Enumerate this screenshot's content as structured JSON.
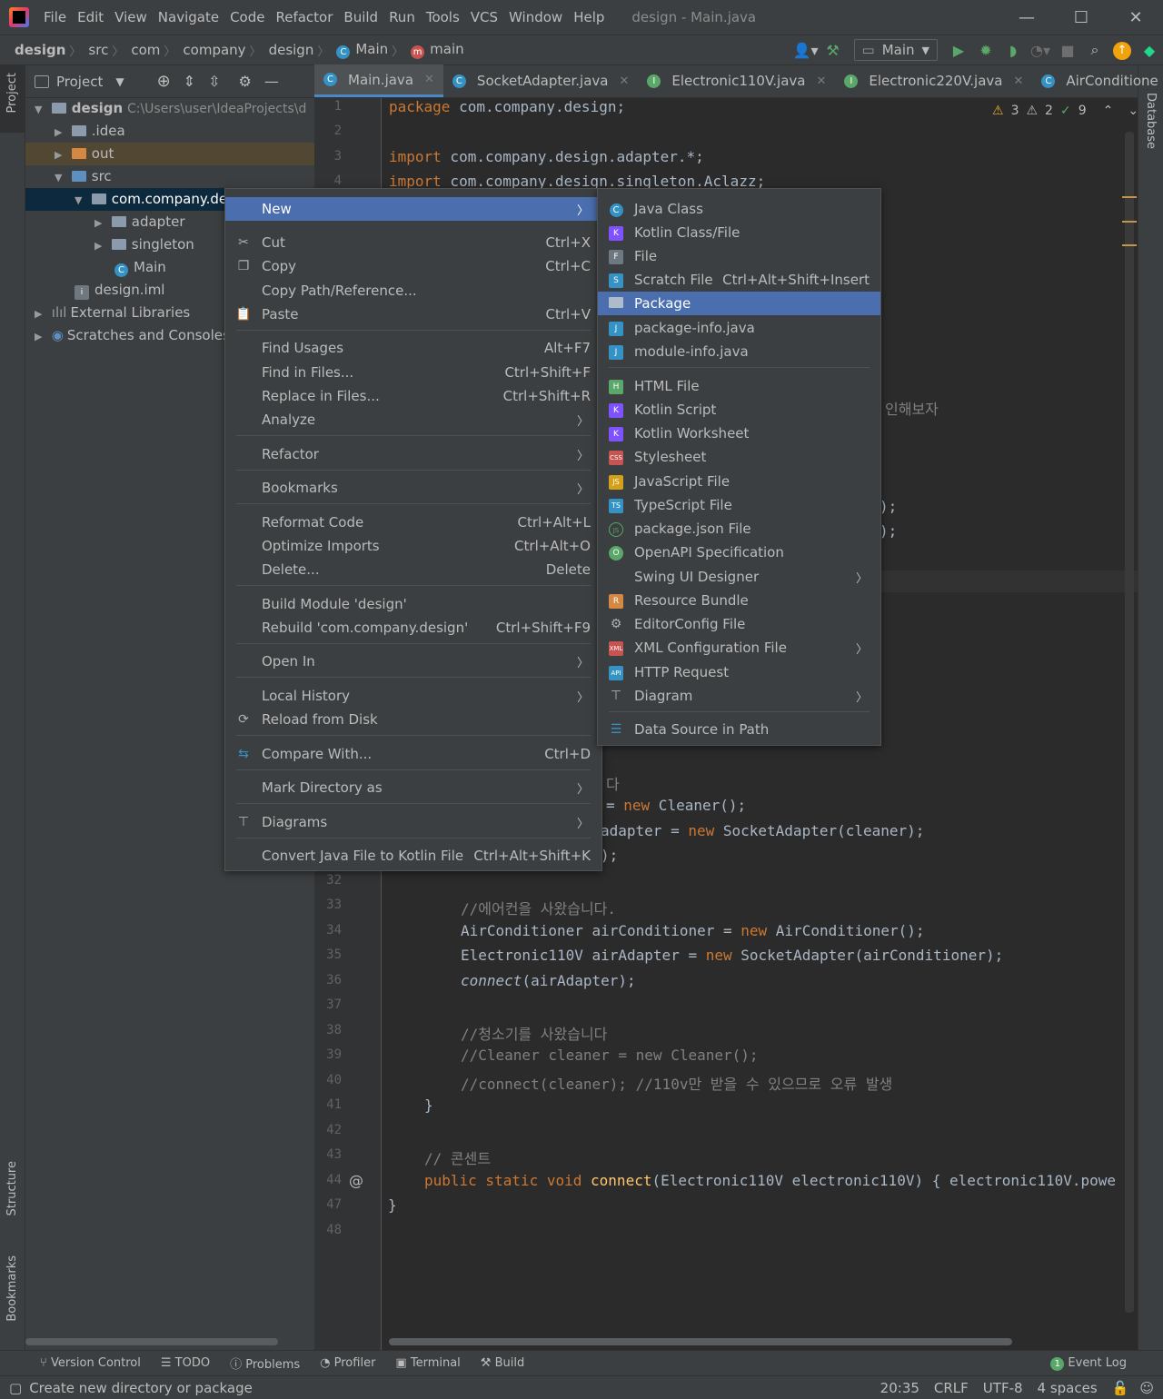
{
  "menubar": {
    "items": [
      "File",
      "Edit",
      "View",
      "Navigate",
      "Code",
      "Refactor",
      "Build",
      "Run",
      "Tools",
      "VCS",
      "Window",
      "Help"
    ],
    "title": "design - Main.java"
  },
  "navbar": {
    "crumbs": [
      "design",
      "src",
      "com",
      "company",
      "design",
      "Main",
      "main"
    ],
    "run_config": "Main"
  },
  "left_strip": {
    "project": "Project",
    "structure": "Structure",
    "bookmarks": "Bookmarks"
  },
  "right_strip": {
    "database": "Database"
  },
  "project_panel": {
    "title": "Project",
    "tree": [
      {
        "label": "design",
        "path": "C:\\Users\\user\\IdeaProjects\\d",
        "bold": true
      },
      {
        "label": ".idea"
      },
      {
        "label": "out"
      },
      {
        "label": "src"
      },
      {
        "label": "com.company.des"
      },
      {
        "label": "adapter"
      },
      {
        "label": "singleton"
      },
      {
        "label": "Main"
      },
      {
        "label": "design.iml"
      },
      {
        "label": "External Libraries"
      },
      {
        "label": "Scratches and Consoles"
      }
    ]
  },
  "tabs": [
    "Main.java",
    "SocketAdapter.java",
    "Electronic110V.java",
    "Electronic220V.java",
    "AirConditione"
  ],
  "inspections": {
    "warnings": "3",
    "weak_warnings": "2",
    "typos": "9"
  },
  "editor": {
    "line_numbers": [
      "1",
      "2",
      "3",
      "4",
      "32",
      "33",
      "34",
      "35",
      "36",
      "37",
      "38",
      "39",
      "40",
      "41",
      "42",
      "43",
      "44",
      "47",
      "48"
    ],
    "code": {
      "l1_kw": "package",
      "l1_rest": " com.company.design;",
      "l3_kw": "import",
      "l3_rest": " com.company.design.adapter.*;",
      "l4_kw": "import",
      "l4_rest": " com.company.design.singleton.Aclazz;",
      "frag_korean": "인해보자",
      "frag_a": ");",
      "frag_b": ");",
      "frag_da": "다",
      "frag_c1": "= ",
      "frag_c2": "new",
      " frag_c3": " Cleaner();",
      "frag_d1": "adapter = ",
      "frag_d2": "new",
      "frag_d3": " SocketAdapter(cleaner);",
      "frag_e": ");",
      "l33": "//에어컨을 사왔습니다.",
      "l34_a": "AirConditioner airConditioner = ",
      "l34_b": "new",
      "l34_c": " AirConditioner();",
      "l35_a": "Electronic110V airAdapter = ",
      "l35_b": "new",
      "l35_c": " SocketAdapter(airConditioner);",
      "l36_a": "connect",
      "l36_b": "(airAdapter);",
      "l38": "//청소기를 사왔습니다",
      "l39": "//Cleaner cleaner = new Cleaner();",
      "l40": "//connect(cleaner); //110v만 받을 수 있으므로 오류 발생",
      "l41": "}",
      "l43": "// 콘센트",
      "l44_a": "public static void ",
      "l44_b": "connect",
      "l44_c": "(Electronic110V electronic110V) { electronic110V.powe",
      "l47": "}"
    }
  },
  "context_menu": {
    "items": [
      {
        "label": "New",
        "shortcut": "",
        "submenu": true
      },
      {
        "label": "Cut",
        "shortcut": "Ctrl+X"
      },
      {
        "label": "Copy",
        "shortcut": "Ctrl+C"
      },
      {
        "label": "Copy Path/Reference...",
        "shortcut": ""
      },
      {
        "label": "Paste",
        "shortcut": "Ctrl+V"
      },
      {
        "label": "Find Usages",
        "shortcut": "Alt+F7"
      },
      {
        "label": "Find in Files...",
        "shortcut": "Ctrl+Shift+F"
      },
      {
        "label": "Replace in Files...",
        "shortcut": "Ctrl+Shift+R"
      },
      {
        "label": "Analyze",
        "shortcut": "",
        "submenu": true
      },
      {
        "label": "Refactor",
        "shortcut": "",
        "submenu": true
      },
      {
        "label": "Bookmarks",
        "shortcut": "",
        "submenu": true
      },
      {
        "label": "Reformat Code",
        "shortcut": "Ctrl+Alt+L"
      },
      {
        "label": "Optimize Imports",
        "shortcut": "Ctrl+Alt+O"
      },
      {
        "label": "Delete...",
        "shortcut": "Delete"
      },
      {
        "label": "Build Module 'design'",
        "shortcut": ""
      },
      {
        "label": "Rebuild 'com.company.design'",
        "shortcut": "Ctrl+Shift+F9"
      },
      {
        "label": "Open In",
        "shortcut": "",
        "submenu": true
      },
      {
        "label": "Local History",
        "shortcut": "",
        "submenu": true
      },
      {
        "label": "Reload from Disk",
        "shortcut": ""
      },
      {
        "label": "Compare With...",
        "shortcut": "Ctrl+D"
      },
      {
        "label": "Mark Directory as",
        "shortcut": "",
        "submenu": true
      },
      {
        "label": "Diagrams",
        "shortcut": "",
        "submenu": true
      },
      {
        "label": "Convert Java File to Kotlin File",
        "shortcut": "Ctrl+Alt+Shift+K"
      }
    ]
  },
  "new_submenu": {
    "items": [
      {
        "label": "Java Class",
        "shortcut": ""
      },
      {
        "label": "Kotlin Class/File",
        "shortcut": ""
      },
      {
        "label": "File",
        "shortcut": ""
      },
      {
        "label": "Scratch File",
        "shortcut": "Ctrl+Alt+Shift+Insert"
      },
      {
        "label": "Package",
        "shortcut": ""
      },
      {
        "label": "package-info.java",
        "shortcut": ""
      },
      {
        "label": "module-info.java",
        "shortcut": ""
      },
      {
        "label": "HTML File",
        "shortcut": ""
      },
      {
        "label": "Kotlin Script",
        "shortcut": ""
      },
      {
        "label": "Kotlin Worksheet",
        "shortcut": ""
      },
      {
        "label": "Stylesheet",
        "shortcut": ""
      },
      {
        "label": "JavaScript File",
        "shortcut": ""
      },
      {
        "label": "TypeScript File",
        "shortcut": ""
      },
      {
        "label": "package.json File",
        "shortcut": ""
      },
      {
        "label": "OpenAPI Specification",
        "shortcut": ""
      },
      {
        "label": "Swing UI Designer",
        "shortcut": "",
        "submenu": true
      },
      {
        "label": "Resource Bundle",
        "shortcut": ""
      },
      {
        "label": "EditorConfig File",
        "shortcut": ""
      },
      {
        "label": "XML Configuration File",
        "shortcut": "",
        "submenu": true
      },
      {
        "label": "HTTP Request",
        "shortcut": ""
      },
      {
        "label": "Diagram",
        "shortcut": "",
        "submenu": true
      },
      {
        "label": "Data Source in Path",
        "shortcut": ""
      }
    ],
    "icon_tags": [
      "C",
      "K",
      "F",
      "S",
      "P",
      "J",
      "J",
      "H",
      "K",
      "K",
      "CSS",
      "JS",
      "TS",
      "JS",
      "O",
      "",
      "R",
      "E",
      "XML",
      "API",
      "D",
      "DB"
    ]
  },
  "bottom_tools": [
    "Version Control",
    "TODO",
    "Problems",
    "Profiler",
    "Terminal",
    "Build"
  ],
  "event_log": {
    "count": "1",
    "label": "Event Log"
  },
  "status": {
    "message": "Create new directory or package",
    "position": "20:35",
    "line_sep": "CRLF",
    "encoding": "UTF-8",
    "indent": "4 spaces"
  },
  "colors": {
    "selection": "#4b6eaf",
    "keyword": "#cc7832",
    "comment": "#808080",
    "function": "#ffc66d",
    "bg": "#2b2b2b",
    "panel": "#3c3f41"
  }
}
